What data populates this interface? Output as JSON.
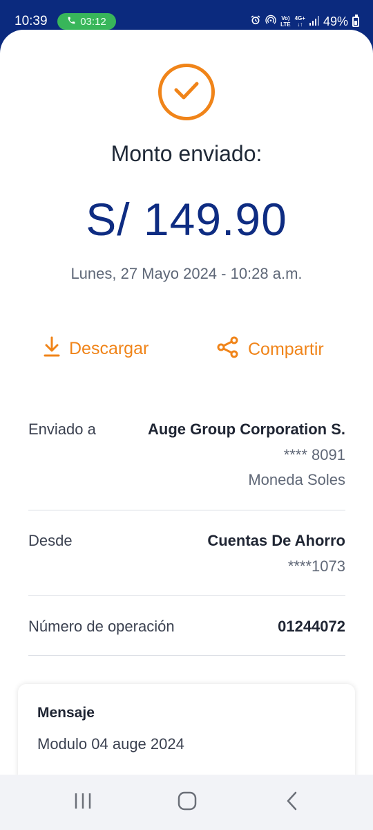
{
  "status_bar": {
    "time": "10:39",
    "call_timer": "03:12",
    "volte": "Vo)\nLTE",
    "network": "4G+",
    "battery": "49%",
    "icons": [
      "phone-icon",
      "alarm-icon",
      "hotspot-icon",
      "volte-icon",
      "network-4g-icon",
      "signal-icon",
      "battery-icon"
    ]
  },
  "receipt": {
    "title": "Monto enviado:",
    "amount": "S/ 149.90",
    "datetime": "Lunes, 27 Mayo 2024 - 10:28 a.m."
  },
  "actions": {
    "download_label": "Descargar",
    "share_label": "Compartir"
  },
  "details": {
    "sent_to": {
      "label": "Enviado a",
      "name": "Auge Group Corporation S.",
      "account": "**** 8091",
      "currency": "Moneda Soles"
    },
    "from": {
      "label": "Desde",
      "account_type": "Cuentas De Ahorro",
      "account": "****1073"
    },
    "operation": {
      "label": "Número de operación",
      "number": "01244072"
    }
  },
  "message": {
    "title": "Mensaje",
    "body": "Modulo 04 auge 2024"
  },
  "colors": {
    "brand_blue": "#0b2a7e",
    "accent_orange": "#f08419",
    "call_green": "#38b65a"
  }
}
